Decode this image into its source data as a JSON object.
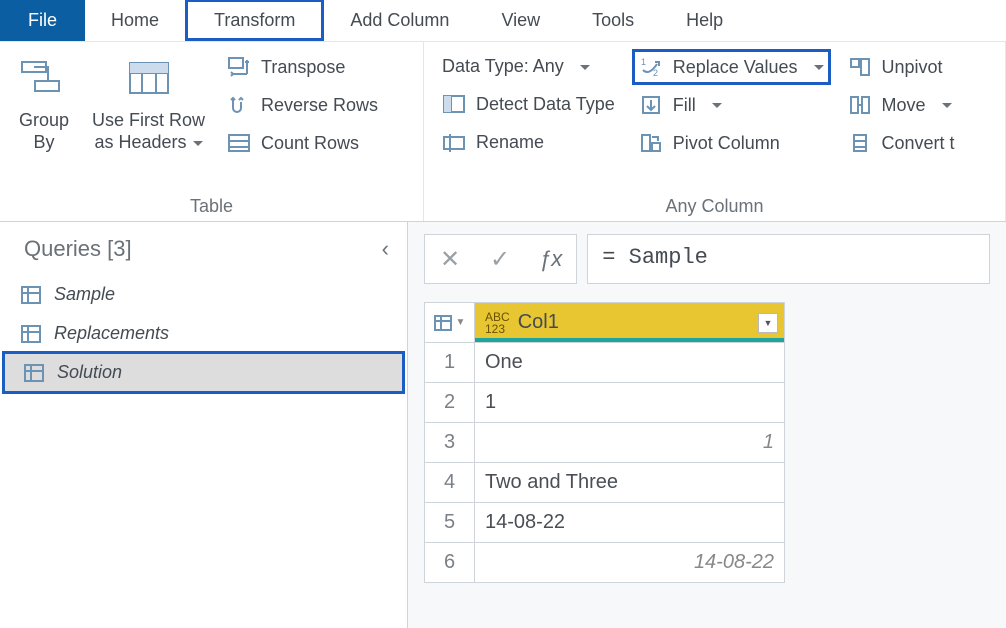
{
  "menu": {
    "file": "File",
    "home": "Home",
    "transform": "Transform",
    "add_column": "Add Column",
    "view": "View",
    "tools": "Tools",
    "help": "Help"
  },
  "ribbon": {
    "table_group": {
      "label": "Table",
      "group_by": "Group\nBy",
      "use_first_row": "Use First Row\nas Headers",
      "transpose": "Transpose",
      "reverse_rows": "Reverse Rows",
      "count_rows": "Count Rows"
    },
    "any_column_group": {
      "label": "Any Column",
      "data_type": "Data Type: Any",
      "detect": "Detect Data Type",
      "rename": "Rename",
      "replace_values": "Replace Values",
      "fill": "Fill",
      "pivot": "Pivot Column",
      "unpivot": "Unpivot",
      "move": "Move",
      "convert": "Convert t"
    }
  },
  "queries": {
    "title": "Queries [3]",
    "items": [
      {
        "label": "Sample"
      },
      {
        "label": "Replacements"
      },
      {
        "label": "Solution"
      }
    ]
  },
  "formula": {
    "text": "= Sample"
  },
  "grid": {
    "column": "Col1",
    "rows": [
      {
        "n": "1",
        "v": "One",
        "align": "left"
      },
      {
        "n": "2",
        "v": "1",
        "align": "left"
      },
      {
        "n": "3",
        "v": "1",
        "align": "rightitalic"
      },
      {
        "n": "4",
        "v": "Two and Three",
        "align": "left"
      },
      {
        "n": "5",
        "v": "14-08-22",
        "align": "left"
      },
      {
        "n": "6",
        "v": "14-08-22",
        "align": "rightitalic"
      }
    ]
  },
  "chart_data": {
    "type": "table",
    "columns": [
      "Col1"
    ],
    "rows": [
      [
        "One"
      ],
      [
        "1"
      ],
      [
        "1"
      ],
      [
        "Two and Three"
      ],
      [
        "14-08-22"
      ],
      [
        "14-08-22"
      ]
    ]
  }
}
